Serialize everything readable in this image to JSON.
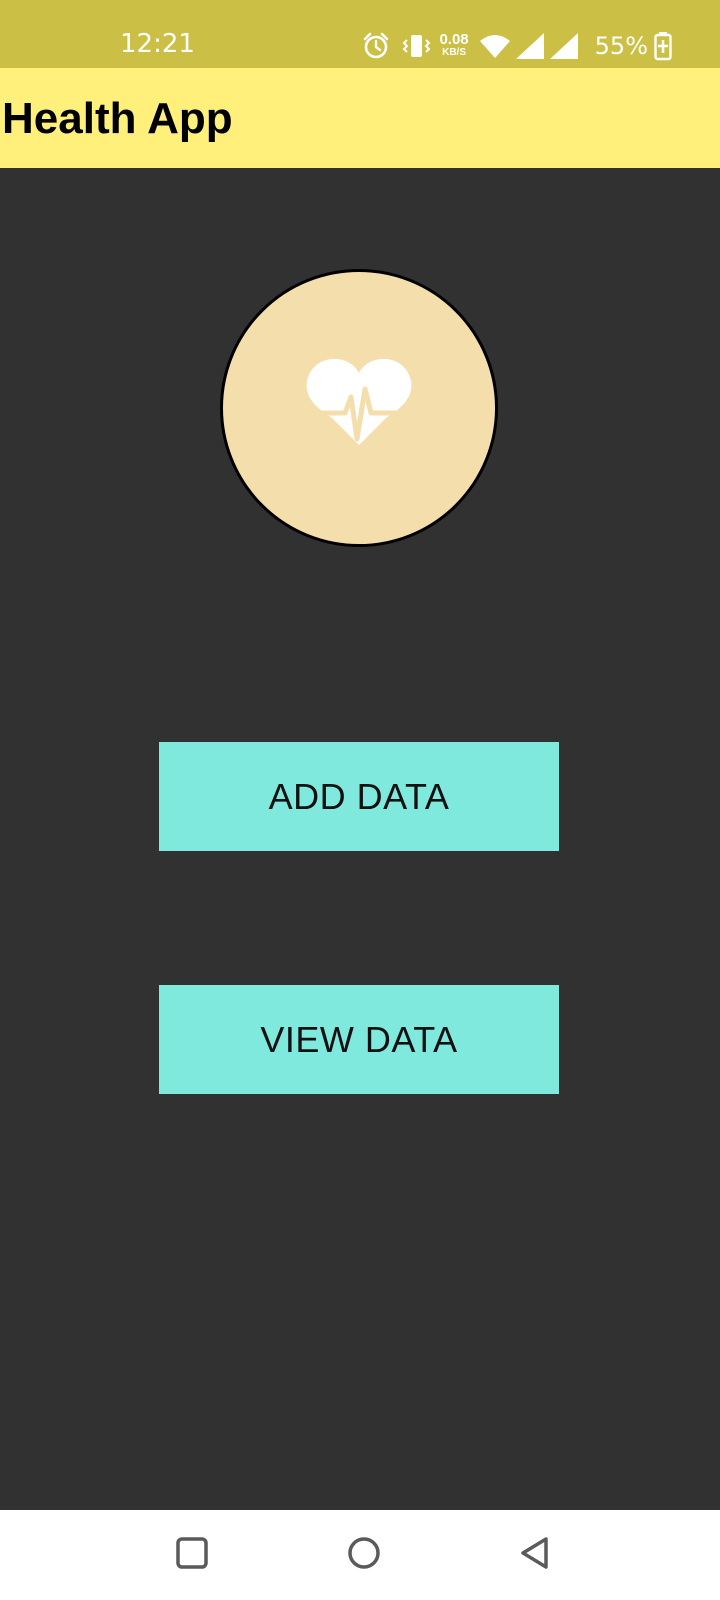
{
  "status_bar": {
    "time": "12:21",
    "net_speed_value": "0.08",
    "net_speed_unit": "KB/S",
    "battery": "55%",
    "icons": [
      "alarm-icon",
      "vibrate-icon",
      "wifi-icon",
      "signal-icon",
      "signal-icon",
      "battery-charging-icon"
    ]
  },
  "app_bar": {
    "title": "Health App"
  },
  "main": {
    "logo_icon": "heart-pulse-icon",
    "add_button": "ADD DATA",
    "view_button": "VIEW DATA"
  },
  "nav_bar": {
    "icons": [
      "recents-icon",
      "home-icon",
      "back-icon"
    ]
  },
  "colors": {
    "status_bar": "#cbc045",
    "app_bar": "#fff07b",
    "background": "#313131",
    "logo_circle": "#f4deac",
    "button": "#80e9de"
  }
}
